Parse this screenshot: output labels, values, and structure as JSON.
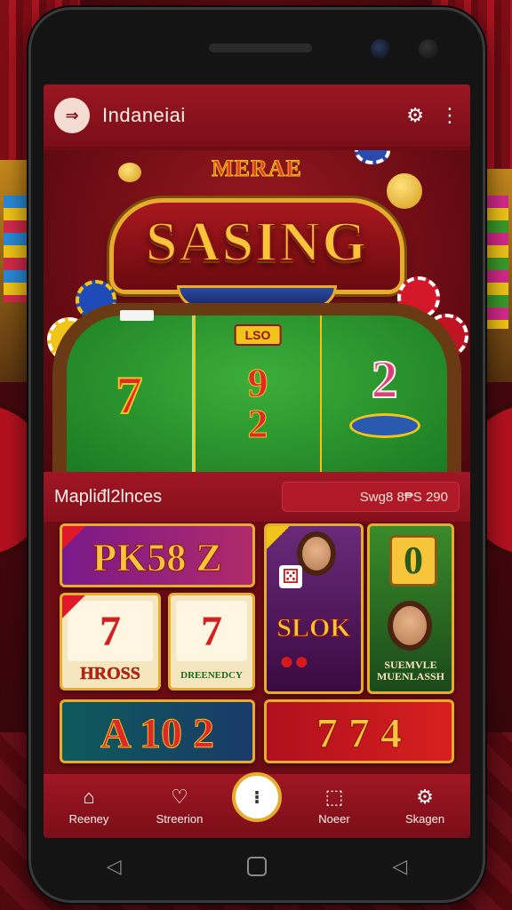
{
  "app": {
    "title": "Indaneiai",
    "logo_glyph": "⇒",
    "icons": [
      "gear-icon",
      "more-vert-icon"
    ]
  },
  "hero": {
    "subtitle": "MERAE",
    "title": "SASING",
    "table": {
      "left_number": "7",
      "badge": "LSO",
      "mid_number_top": "9",
      "mid_number_bottom": "2",
      "right_number": "2"
    }
  },
  "section": {
    "title": "Mapliđl2lnces",
    "stat": "Swg8 8₱S  290"
  },
  "tiles": {
    "t1": "PK58 Z",
    "t2_reel": "7",
    "t2_label": "HROSS",
    "t3_reel": "7",
    "t3_label": "DREENEDCY",
    "t4_label": "SLOK",
    "t5_number": "0",
    "t5_label_line1": "SUEMVLE",
    "t5_label_line2": "MUENLASSH",
    "t6": "A 10 2",
    "t7": "7 7 4"
  },
  "bottom_nav": {
    "items": [
      {
        "label": "Reeney",
        "icon": "home-icon"
      },
      {
        "label": "Streerion",
        "icon": "heart-location-icon"
      },
      {
        "label": "",
        "icon": "center-action-icon"
      },
      {
        "label": "Noeer",
        "icon": "bag-icon"
      },
      {
        "label": "Skagen",
        "icon": "settings-icon"
      }
    ]
  },
  "colors": {
    "primary": "#7a0e18",
    "gold": "#e6ad2a",
    "felt": "#1a7a22"
  }
}
